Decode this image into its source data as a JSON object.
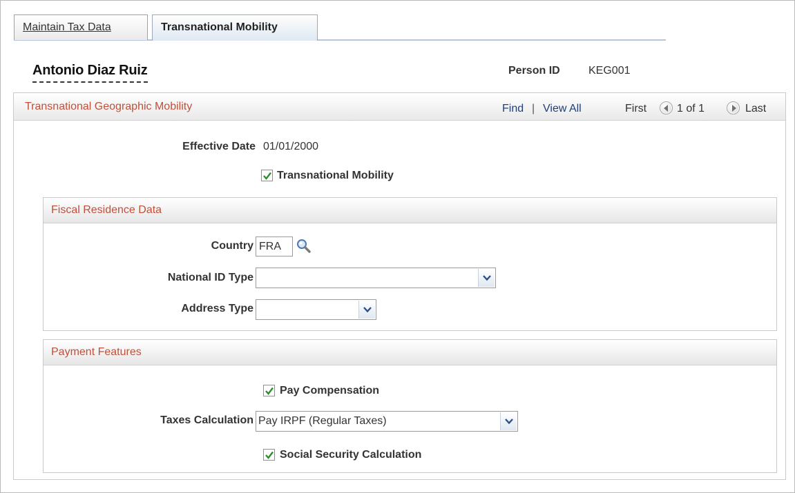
{
  "tabs": [
    {
      "label": "Maintain Tax Data",
      "active": false
    },
    {
      "label": "Transnational Mobility",
      "active": true
    }
  ],
  "person": {
    "name": "Antonio Diaz Ruiz",
    "id_label": "Person ID",
    "id_value": "KEG001"
  },
  "main_section": {
    "title": "Transnational Geographic Mobility",
    "nav": {
      "find": "Find",
      "separator": "|",
      "view_all": "View All",
      "first": "First",
      "position": "1 of 1",
      "last": "Last"
    },
    "effective_date_label": "Effective Date",
    "effective_date_value": "01/01/2000",
    "transnational_mobility_label": "Transnational Mobility",
    "transnational_mobility_checked": true
  },
  "fiscal_residence": {
    "title": "Fiscal Residence Data",
    "country_label": "Country",
    "country_value": "FRA",
    "national_id_type_label": "National ID Type",
    "national_id_type_value": "",
    "address_type_label": "Address Type",
    "address_type_value": ""
  },
  "payment_features": {
    "title": "Payment Features",
    "pay_compensation_label": "Pay Compensation",
    "pay_compensation_checked": true,
    "taxes_calculation_label": "Taxes Calculation",
    "taxes_calculation_value": "Pay IRPF (Regular Taxes)",
    "social_security_label": "Social Security Calculation",
    "social_security_checked": true
  },
  "colors": {
    "section_title": "#c0503a",
    "link": "#1f3f7a",
    "checkmark": "#2e8a2e"
  },
  "icons": {
    "lookup": "magnifier-icon",
    "prev": "previous-icon",
    "next": "next-icon",
    "dropdown": "chevron-down-icon",
    "check": "checkmark-icon"
  }
}
